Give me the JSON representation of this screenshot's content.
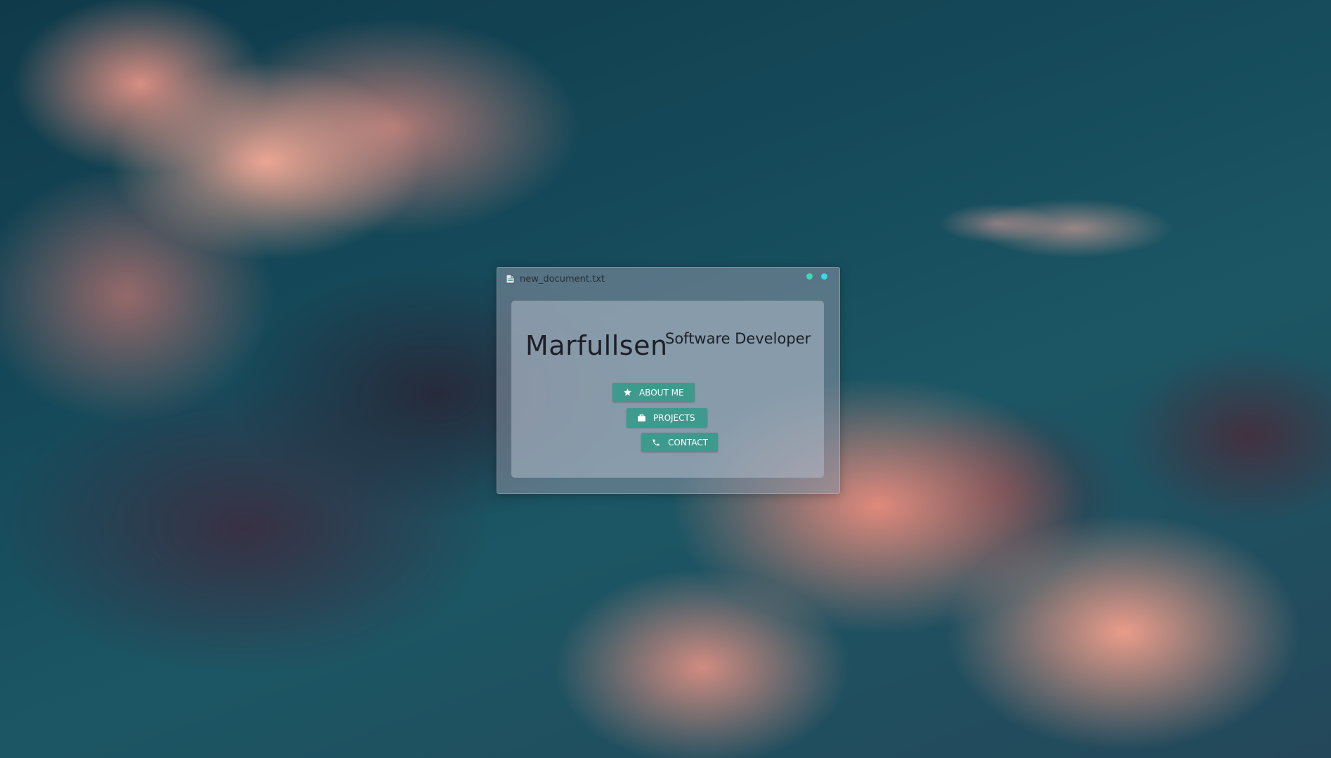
{
  "window": {
    "title": "new_document.txt",
    "icons": {
      "file": "document-icon"
    },
    "controls": [
      {
        "name": "minimize-dot",
        "color": "#3fd6b0"
      },
      {
        "name": "close-dot",
        "color": "#37d9e8"
      }
    ]
  },
  "header": {
    "name": "Marfullsen",
    "role": "Software Developer"
  },
  "buttons": {
    "about": {
      "label": "ABOUT ME",
      "icon": "star-icon"
    },
    "projects": {
      "label": "PROJECTS",
      "icon": "briefcase-icon"
    },
    "contact": {
      "label": "CONTACT",
      "icon": "phone-icon"
    }
  },
  "colors": {
    "accent": "#3f9a8e"
  }
}
